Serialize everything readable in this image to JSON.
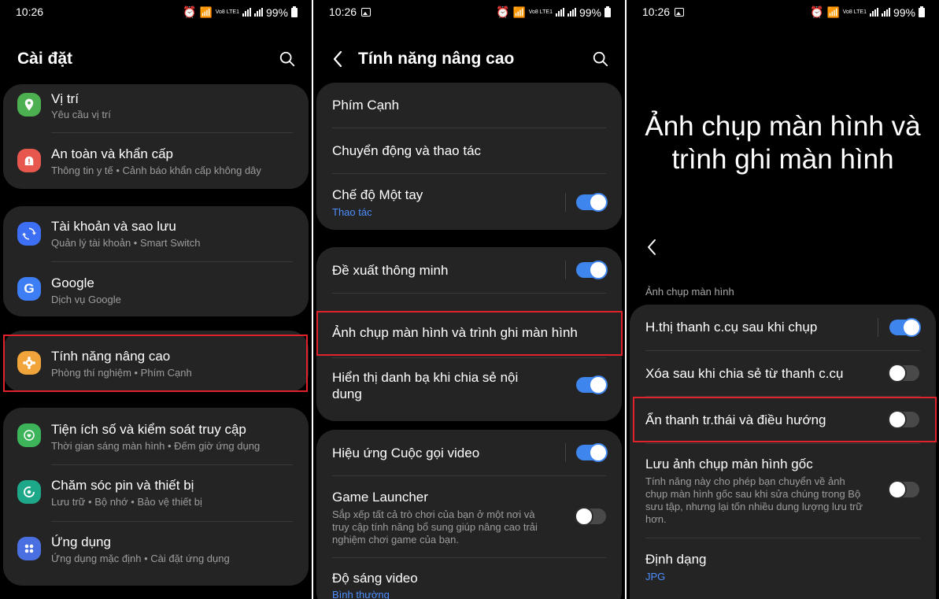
{
  "status": {
    "time": "10:26",
    "battery": "99%",
    "lte": "Vo8 LTE1"
  },
  "screen1": {
    "title": "Cài đặt",
    "items": [
      {
        "title": "Vị trí",
        "subtitle": "Yêu cầu vị trí",
        "icon": "location-icon",
        "color": "#4caf50"
      },
      {
        "title": "An toàn và khẩn cấp",
        "subtitle": "Thông tin y tế  •  Cảnh báo khẩn cấp không dây",
        "icon": "emergency-icon",
        "color": "#e8574e"
      },
      {
        "title": "Tài khoản và sao lưu",
        "subtitle": "Quản lý tài khoản  •  Smart Switch",
        "icon": "sync-icon",
        "color": "#3d6ff5"
      },
      {
        "title": "Google",
        "subtitle": "Dịch vụ Google",
        "icon": "google-icon",
        "color": "#3d7ef5"
      },
      {
        "title": "Tính năng nâng cao",
        "subtitle": "Phòng thí nghiệm  •  Phím Cạnh",
        "icon": "gear-plus-icon",
        "color": "#f0a43a"
      },
      {
        "title": "Tiện ích số và kiểm soát truy cập",
        "subtitle": "Thời gian sáng màn hình  •  Đếm giờ ứng dụng",
        "icon": "wellbeing-icon",
        "color": "#3db45a"
      },
      {
        "title": "Chăm sóc pin và thiết bị",
        "subtitle": "Lưu trữ  •  Bộ nhớ  •  Bảo vệ thiết bị",
        "icon": "device-care-icon",
        "color": "#1ea88a"
      },
      {
        "title": "Ứng dụng",
        "subtitle": "Ứng dụng mặc định  •  Cài đặt ứng dụng",
        "icon": "apps-icon",
        "color": "#4a6fe0"
      }
    ]
  },
  "screen2": {
    "title": "Tính năng nâng cao",
    "items": [
      {
        "title": "Phím Cạnh"
      },
      {
        "title": "Chuyển động và thao tác"
      },
      {
        "title": "Chế độ Một tay",
        "subtitle": "Thao tác",
        "toggle": true
      },
      {
        "title": "Đề xuất thông minh",
        "toggle": true
      },
      {
        "title": "Ảnh chụp màn hình và trình ghi màn hình"
      },
      {
        "title": "Hiển thị danh bạ khi chia sẻ nội",
        "title2": "dung",
        "toggle": true
      },
      {
        "title": "Hiệu ứng Cuộc gọi video",
        "toggle": true
      },
      {
        "title": "Game Launcher",
        "desc1": "Sắp xếp tất cả trò chơi của bạn ở một nơi và",
        "desc2": "truy cập tính năng bổ sung giúp nâng cao trải",
        "desc3": "nghiệm chơi game của bạn.",
        "toggle": false
      },
      {
        "title": "Độ sáng video",
        "subtitle": "Bình thường"
      }
    ]
  },
  "screen3": {
    "title_line1": "Ảnh chụp màn hình và",
    "title_line2": "trình ghi màn hình",
    "section": "Ảnh chụp màn hình",
    "items": [
      {
        "title": "H.thị thanh c.cụ sau khi chụp",
        "toggle": true
      },
      {
        "title": "Xóa sau khi chia sẻ từ thanh c.cụ",
        "toggle": false
      },
      {
        "title": "Ẩn thanh tr.thái và điều hướng",
        "toggle": false
      },
      {
        "title": "Lưu ảnh chụp màn hình gốc",
        "desc1": "Tính năng này cho phép bạn chuyển về ảnh",
        "desc2": "chụp màn hình gốc sau khi sửa chúng trong Bộ",
        "desc3": "sưu tập, nhưng lại tốn nhiều dung lượng lưu trữ",
        "desc4": "hơn.",
        "toggle": false
      },
      {
        "title": "Định dạng",
        "subtitle": "JPG"
      }
    ]
  },
  "accent": "#3e85ee",
  "highlight": "#e0232b"
}
